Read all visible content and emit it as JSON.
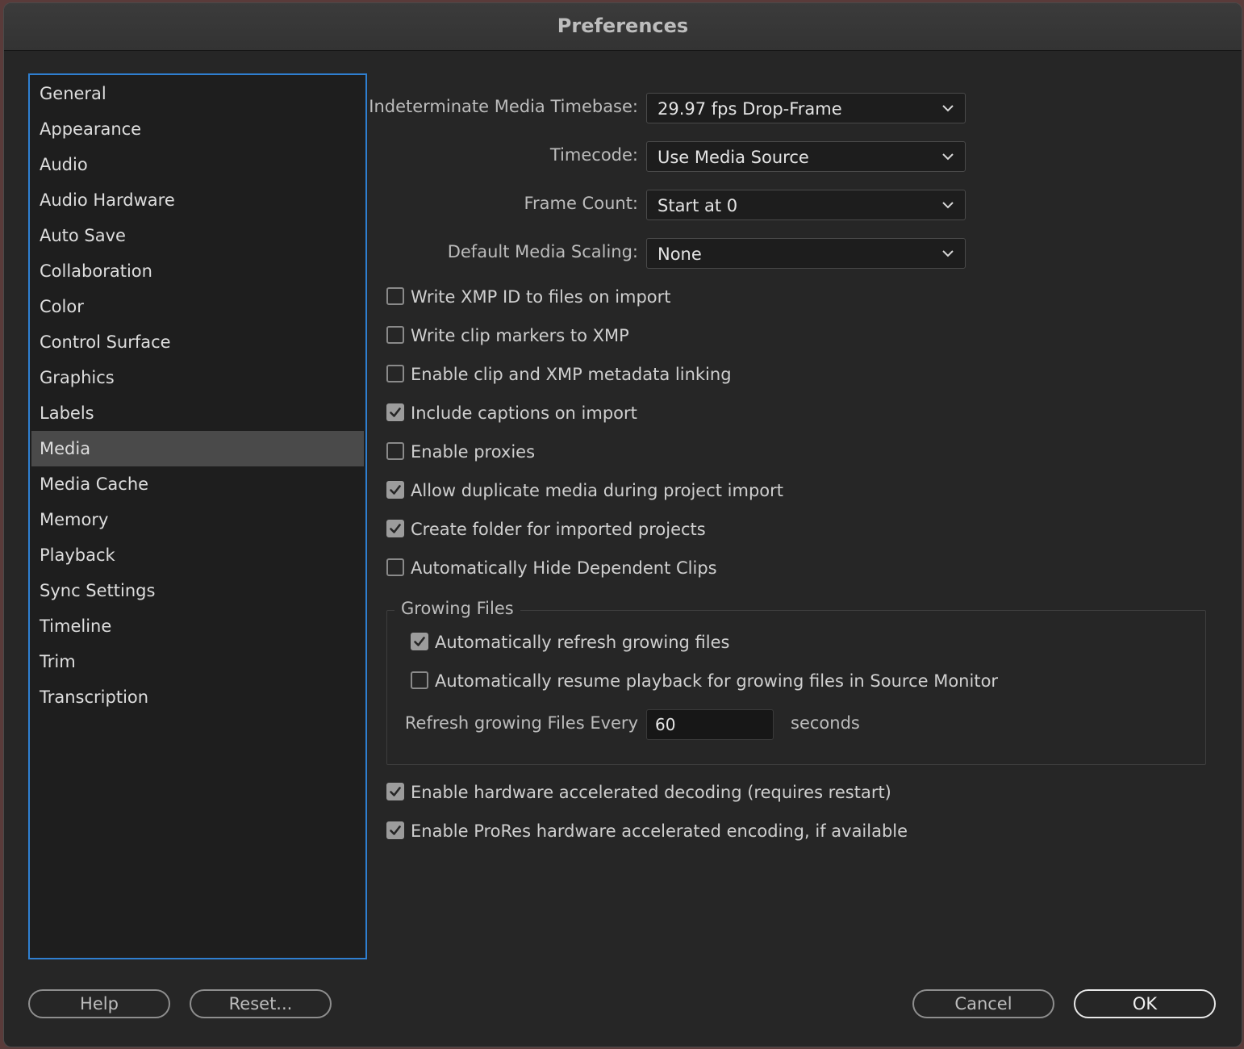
{
  "window": {
    "title": "Preferences"
  },
  "sidebar": {
    "items": [
      {
        "label": "General"
      },
      {
        "label": "Appearance"
      },
      {
        "label": "Audio"
      },
      {
        "label": "Audio Hardware"
      },
      {
        "label": "Auto Save"
      },
      {
        "label": "Collaboration"
      },
      {
        "label": "Color"
      },
      {
        "label": "Control Surface"
      },
      {
        "label": "Graphics"
      },
      {
        "label": "Labels"
      },
      {
        "label": "Media",
        "selected": true
      },
      {
        "label": "Media Cache"
      },
      {
        "label": "Memory"
      },
      {
        "label": "Playback"
      },
      {
        "label": "Sync Settings"
      },
      {
        "label": "Timeline"
      },
      {
        "label": "Trim"
      },
      {
        "label": "Transcription"
      }
    ]
  },
  "media": {
    "timebase": {
      "label": "Indeterminate Media Timebase:",
      "value": "29.97 fps Drop-Frame"
    },
    "timecode": {
      "label": "Timecode:",
      "value": "Use Media Source"
    },
    "frame_count": {
      "label": "Frame Count:",
      "value": "Start at 0"
    },
    "scaling": {
      "label": "Default Media Scaling:",
      "value": "None"
    },
    "options": [
      {
        "label": "Write XMP ID to files on import",
        "checked": false
      },
      {
        "label": "Write clip markers to XMP",
        "checked": false
      },
      {
        "label": "Enable clip and XMP metadata linking",
        "checked": false
      },
      {
        "label": "Include captions on import",
        "checked": true
      },
      {
        "label": "Enable proxies",
        "checked": false
      },
      {
        "label": "Allow duplicate media during project import",
        "checked": true
      },
      {
        "label": "Create folder for imported projects",
        "checked": true
      },
      {
        "label": "Automatically Hide Dependent Clips",
        "checked": false
      }
    ],
    "growing_files": {
      "title": "Growing Files",
      "options": [
        {
          "label": "Automatically refresh growing files",
          "checked": true
        },
        {
          "label": "Automatically resume playback for growing files in Source Monitor",
          "checked": false
        }
      ],
      "refresh_label": "Refresh growing Files Every",
      "refresh_value": "60",
      "refresh_unit": "seconds"
    },
    "hardware_options": [
      {
        "label": "Enable hardware accelerated decoding (requires restart)",
        "checked": true
      },
      {
        "label": "Enable ProRes hardware accelerated encoding, if available",
        "checked": true
      }
    ]
  },
  "footer": {
    "help_label": "Help",
    "reset_label": "Reset...",
    "cancel_label": "Cancel",
    "ok_label": "OK"
  },
  "colors": {
    "accent": "#2f7fd0",
    "background": "#262626",
    "selected": "#4a4a4a"
  }
}
